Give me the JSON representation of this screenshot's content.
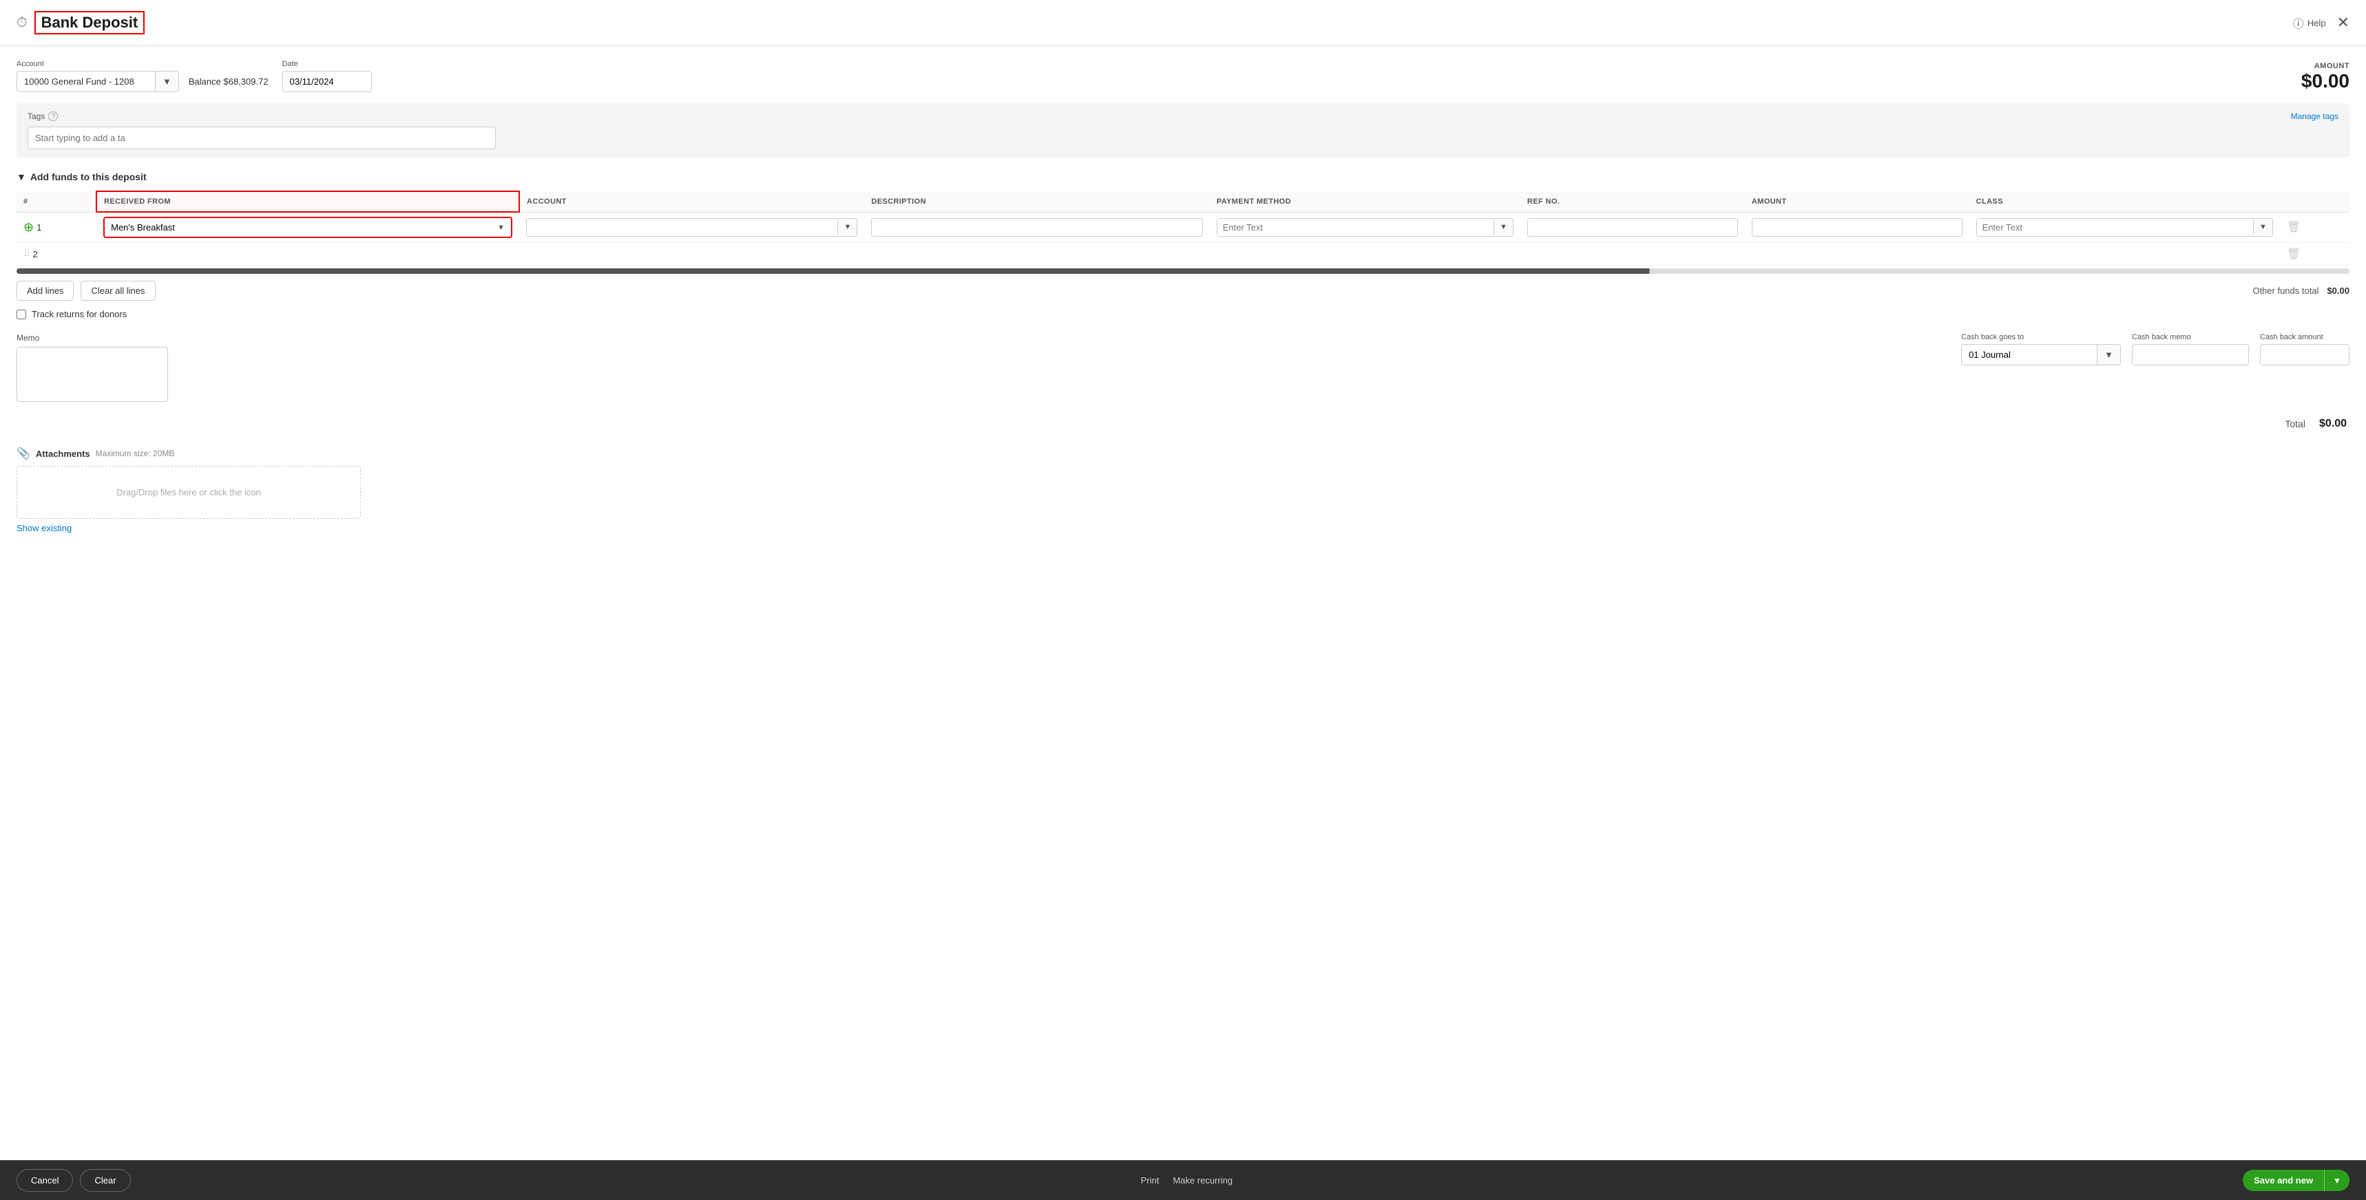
{
  "header": {
    "title": "Bank Deposit",
    "help_label": "Help",
    "title_icon": "⏰"
  },
  "form": {
    "account": {
      "label": "Account",
      "value": "10000 General Fund - 1208",
      "balance_prefix": "Balance",
      "balance_value": "$68,309.72"
    },
    "date": {
      "label": "Date",
      "value": "03/11/2024"
    },
    "amount": {
      "label": "AMOUNT",
      "value": "$0.00"
    },
    "tags": {
      "label": "Tags",
      "manage_label": "Manage tags",
      "placeholder": "Start typing to add a ta"
    },
    "add_funds_title": "Add funds to this deposit",
    "table": {
      "columns": [
        {
          "key": "num",
          "label": "#"
        },
        {
          "key": "received_from",
          "label": "RECEIVED FROM"
        },
        {
          "key": "account",
          "label": "ACCOUNT"
        },
        {
          "key": "description",
          "label": "DESCRIPTION"
        },
        {
          "key": "payment_method",
          "label": "PAYMENT METHOD"
        },
        {
          "key": "ref_no",
          "label": "REF NO."
        },
        {
          "key": "amount",
          "label": "AMOUNT"
        },
        {
          "key": "class",
          "label": "CLASS"
        }
      ],
      "rows": [
        {
          "num": "1",
          "received_from": "Men's Breakfast",
          "account": "",
          "description": "",
          "payment_method": "",
          "ref_no": "",
          "amount": "",
          "class": ""
        },
        {
          "num": "2",
          "received_from": "",
          "account": "",
          "description": "",
          "payment_method": "",
          "ref_no": "",
          "amount": "",
          "class": ""
        }
      ],
      "payment_method_placeholder": "Enter Text",
      "class_placeholder": "Enter Text"
    },
    "add_lines_btn": "Add lines",
    "clear_all_lines_btn": "Clear all lines",
    "other_funds_total_label": "Other funds total",
    "other_funds_total_value": "$0.00",
    "track_returns_label": "Track returns for donors",
    "memo_label": "Memo",
    "cash_back": {
      "goes_to_label": "Cash back goes to",
      "goes_to_value": "01 Journal",
      "memo_label": "Cash back memo",
      "amount_label": "Cash back amount"
    },
    "total_label": "Total",
    "total_value": "$0.00",
    "attachments": {
      "label": "Attachments",
      "max_size": "Maximum size: 20MB",
      "drop_text": "Drag/Drop files here or click the icon",
      "show_existing": "Show existing"
    }
  },
  "footer": {
    "cancel_label": "Cancel",
    "clear_label": "Clear",
    "print_label": "Print",
    "make_recurring_label": "Make recurring",
    "save_and_new_label": "Save and new"
  }
}
